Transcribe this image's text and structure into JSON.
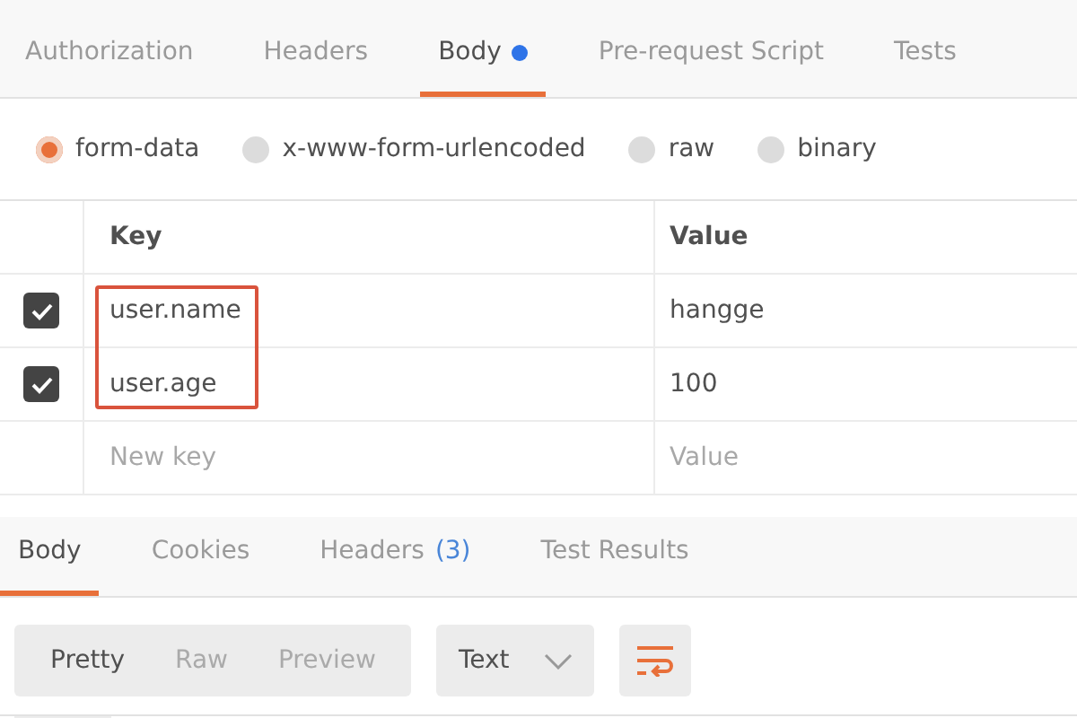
{
  "request_tabs": [
    {
      "label": "Authorization",
      "selected": false,
      "dot": false
    },
    {
      "label": "Headers",
      "selected": false,
      "dot": false
    },
    {
      "label": "Body",
      "selected": true,
      "dot": true
    },
    {
      "label": "Pre-request Script",
      "selected": false,
      "dot": false
    },
    {
      "label": "Tests",
      "selected": false,
      "dot": false
    }
  ],
  "body_types": [
    {
      "label": "form-data",
      "selected": true
    },
    {
      "label": "x-www-form-urlencoded",
      "selected": false
    },
    {
      "label": "raw",
      "selected": false
    },
    {
      "label": "binary",
      "selected": false
    }
  ],
  "table": {
    "columns": [
      "Key",
      "Value"
    ],
    "rows": [
      {
        "checked": true,
        "key": "user.name",
        "value": "hangge",
        "highlighted": true
      },
      {
        "checked": true,
        "key": "user.age",
        "value": "100",
        "highlighted": true
      }
    ],
    "new_row": {
      "key_placeholder": "New key",
      "value_placeholder": "Value"
    }
  },
  "response_tabs": [
    {
      "label": "Body",
      "selected": true
    },
    {
      "label": "Cookies",
      "selected": false
    },
    {
      "label": "Headers",
      "count": "(3)",
      "selected": false
    },
    {
      "label": "Test Results",
      "selected": false
    }
  ],
  "view_modes": [
    {
      "label": "Pretty",
      "selected": true
    },
    {
      "label": "Raw",
      "selected": false
    },
    {
      "label": "Preview",
      "selected": false
    }
  ],
  "format_select": {
    "value": "Text"
  }
}
